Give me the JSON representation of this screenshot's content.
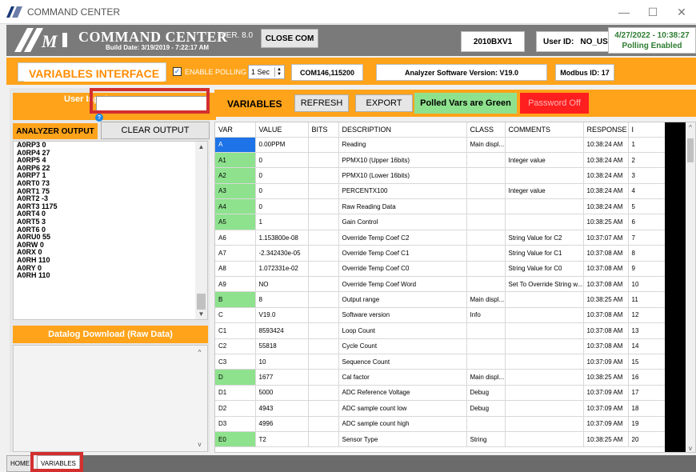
{
  "window": {
    "title": "COMMAND CENTER",
    "controls": {
      "minimize": "—",
      "maximize": "☐",
      "close": "✕"
    }
  },
  "header": {
    "app_name": "COMMAND CENTER",
    "version": "VER. 8.0",
    "build": "Build Date: 3/19/2019 - 7:22:17 AM",
    "close_com_label": "CLOSE COM",
    "device": "2010BXV1",
    "user_id_label": "User ID:",
    "user_id": "NO_USERID",
    "datetime": "4/27/2022 - 10:38:27",
    "polling_status": "Polling Enabled"
  },
  "controls": {
    "title": "VARIABLES INTERFACE",
    "enable_polling_label": "ENABLE POLLING",
    "enable_polling_checked": true,
    "poll_rate": "1 Sec",
    "com_port": "COM146,115200",
    "analyzer_version": "Analyzer Software Version: V19.0",
    "modbus_id": "Modbus ID: 17"
  },
  "left": {
    "user_input_label": "User Input",
    "user_input_value": "",
    "analyzer_output_label": "ANALYZER OUTPUT",
    "clear_output_label": "CLEAR OUTPUT",
    "output_lines": [
      "A0RP3 0",
      "A0RP4 27",
      "A0RP5 4",
      "A0RP6 22",
      "A0RP7 1",
      "A0RT0 73",
      "A0RT1 75",
      "A0RT2 -3",
      "A0RT3 1175",
      "A0RT4 0",
      "A0RT5 3",
      "A0RT6 0",
      "A0RU0 55",
      "A0RW 0",
      "A0RX 0",
      "A0RH 110",
      "A0RY 0",
      "A0RH 110"
    ],
    "datalog_label": "Datalog Download (Raw Data)"
  },
  "right": {
    "variables_label": "VARIABLES",
    "refresh_label": "REFRESH",
    "export_label": "EXPORT",
    "polled_note": "Polled Vars are Green",
    "password_status": "Password Off",
    "columns": [
      "VAR",
      "VALUE",
      "BITS",
      "DESCRIPTION",
      "CLASS",
      "COMMENTS",
      "RESPONSE",
      "I"
    ],
    "rows": [
      {
        "var": "A",
        "value": "0.00PPM",
        "bits": "",
        "desc": "Reading",
        "class": "Main displ...",
        "comments": "",
        "response": "10:38:24 AM",
        "i": "1",
        "style": "blue"
      },
      {
        "var": "A1",
        "value": "0",
        "bits": "",
        "desc": "PPMX10 (Upper 16bits)",
        "class": "",
        "comments": "Integer value",
        "response": "10:38:24 AM",
        "i": "2",
        "style": "green"
      },
      {
        "var": "A2",
        "value": "0",
        "bits": "",
        "desc": "PPMX10 (Lower 16bits)",
        "class": "",
        "comments": "",
        "response": "10:38:24 AM",
        "i": "3",
        "style": "green"
      },
      {
        "var": "A3",
        "value": "0",
        "bits": "",
        "desc": "PERCENTX100",
        "class": "",
        "comments": "Integer value",
        "response": "10:38:24 AM",
        "i": "4",
        "style": "green"
      },
      {
        "var": "A4",
        "value": "0",
        "bits": "",
        "desc": "Raw Reading Data",
        "class": "",
        "comments": "",
        "response": "10:38:24 AM",
        "i": "5",
        "style": "green"
      },
      {
        "var": "A5",
        "value": "1",
        "bits": "",
        "desc": "Gain Control",
        "class": "",
        "comments": "",
        "response": "10:38:25 AM",
        "i": "6",
        "style": "green"
      },
      {
        "var": "A6",
        "value": "1.153800e-08",
        "bits": "",
        "desc": "Override Temp Coef C2",
        "class": "",
        "comments": "String Value for C2",
        "response": "10:37:07 AM",
        "i": "7",
        "style": ""
      },
      {
        "var": "A7",
        "value": "-2.342430e-05",
        "bits": "",
        "desc": "Override Temp Coef C1",
        "class": "",
        "comments": "String Value for C1",
        "response": "10:37:08 AM",
        "i": "8",
        "style": ""
      },
      {
        "var": "A8",
        "value": "1.072331e-02",
        "bits": "",
        "desc": "Override Temp Coef C0",
        "class": "",
        "comments": "String Value for C0",
        "response": "10:37:08 AM",
        "i": "9",
        "style": ""
      },
      {
        "var": "A9",
        "value": "NO",
        "bits": "",
        "desc": "Override Temp Coef Word",
        "class": "",
        "comments": "Set To Override String w...",
        "response": "10:37:08 AM",
        "i": "10",
        "style": ""
      },
      {
        "var": "B",
        "value": "8",
        "bits": "",
        "desc": "Output range",
        "class": "Main displ...",
        "comments": "",
        "response": "10:38:25 AM",
        "i": "11",
        "style": "green"
      },
      {
        "var": "C",
        "value": "V19.0",
        "bits": "",
        "desc": "Software version",
        "class": "Info",
        "comments": "",
        "response": "10:37:08 AM",
        "i": "12",
        "style": ""
      },
      {
        "var": "C1",
        "value": "8593424",
        "bits": "",
        "desc": "Loop Count",
        "class": "",
        "comments": "",
        "response": "10:37:08 AM",
        "i": "13",
        "style": ""
      },
      {
        "var": "C2",
        "value": "55818",
        "bits": "",
        "desc": "Cycle Count",
        "class": "",
        "comments": "",
        "response": "10:37:08 AM",
        "i": "14",
        "style": ""
      },
      {
        "var": "C3",
        "value": "10",
        "bits": "",
        "desc": "Sequence Count",
        "class": "",
        "comments": "",
        "response": "10:37:09 AM",
        "i": "15",
        "style": ""
      },
      {
        "var": "D",
        "value": "1677",
        "bits": "",
        "desc": "Cal factor",
        "class": "Main displ...",
        "comments": "",
        "response": "10:38:25 AM",
        "i": "16",
        "style": "green"
      },
      {
        "var": "D1",
        "value": "5000",
        "bits": "",
        "desc": "ADC Reference Voltage",
        "class": "Debug",
        "comments": "",
        "response": "10:37:09 AM",
        "i": "17",
        "style": ""
      },
      {
        "var": "D2",
        "value": "4943",
        "bits": "",
        "desc": "ADC sample count low",
        "class": "Debug",
        "comments": "",
        "response": "10:37:09 AM",
        "i": "18",
        "style": ""
      },
      {
        "var": "D3",
        "value": "4996",
        "bits": "",
        "desc": "ADC sample count high",
        "class": "",
        "comments": "",
        "response": "10:37:09 AM",
        "i": "19",
        "style": ""
      },
      {
        "var": "E0",
        "value": "T2",
        "bits": "",
        "desc": "Sensor Type",
        "class": "String",
        "comments": "",
        "response": "10:38:25 AM",
        "i": "20",
        "style": "green"
      }
    ]
  },
  "tabs": [
    {
      "label": "HOME",
      "active": false
    },
    {
      "label": "VARIABLES",
      "active": true
    }
  ]
}
